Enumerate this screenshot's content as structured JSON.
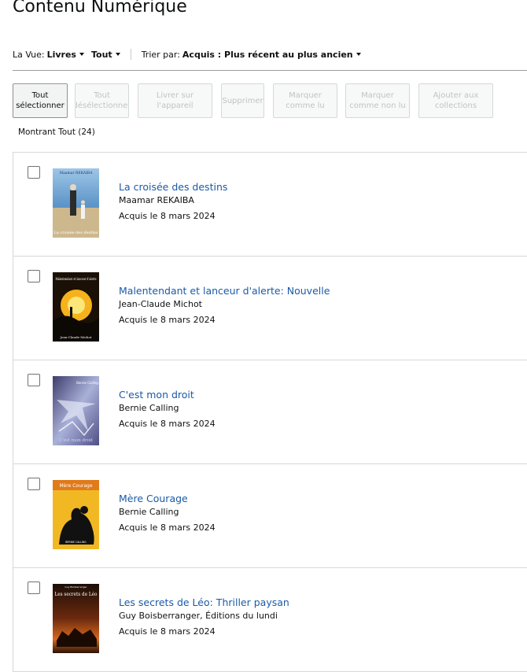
{
  "page": {
    "title": "Contenu Numérique"
  },
  "filters": {
    "view_label": "La Vue:",
    "view_value": "Livres",
    "scope_value": "Tout",
    "sort_label": "Trier par:",
    "sort_value": "Acquis : Plus récent au plus ancien"
  },
  "actions": [
    {
      "label": "Tout sélectionner",
      "enabled": true
    },
    {
      "label": "Tout désélectionner",
      "enabled": false
    },
    {
      "label": "Livrer sur l'appareil",
      "enabled": false
    },
    {
      "label": "Supprimer",
      "enabled": false
    },
    {
      "label": "Marquer comme lu",
      "enabled": false
    },
    {
      "label": "Marquer comme non lu",
      "enabled": false
    },
    {
      "label": "Ajouter aux collections",
      "enabled": false
    }
  ],
  "count_label": "Montrant Tout (24)",
  "items": [
    {
      "title": "La croisée des destins",
      "author": "Maamar REKAIBA",
      "acquired": "Acquis le 8 mars 2024",
      "cover_text_top": "Maamar REKAIBA",
      "cover_text_bottom": "La croisée des destins"
    },
    {
      "title": "Malentendant et lanceur d'alerte: Nouvelle",
      "author": "Jean-Claude Michot",
      "acquired": "Acquis le 8 mars 2024",
      "cover_text_top": "Malentendant et lanceur d'alerte",
      "cover_text_bottom": "Jean-Claude Michot"
    },
    {
      "title": "C'est mon droit",
      "author": "Bernie Calling",
      "acquired": "Acquis le 8 mars 2024",
      "cover_text_top": "Bernie Calling",
      "cover_text_bottom": "C'est mon droit"
    },
    {
      "title": "Mère Courage",
      "author": "Bernie Calling",
      "acquired": "Acquis le 8 mars 2024",
      "cover_text_top": "Mère Courage",
      "cover_text_bottom": "BERNIE CALLING"
    },
    {
      "title": "Les secrets de Léo: Thriller paysan",
      "author": "Guy Boisberranger, Éditions du lundi",
      "acquired": "Acquis le 8 mars 2024",
      "cover_text_top": "Les secrets de Léo",
      "cover_text_bottom": "Guy Boisberranger"
    }
  ],
  "colors": {
    "link": "#1a5aa8",
    "text": "#0f1111",
    "border": "#d5d9d9"
  }
}
